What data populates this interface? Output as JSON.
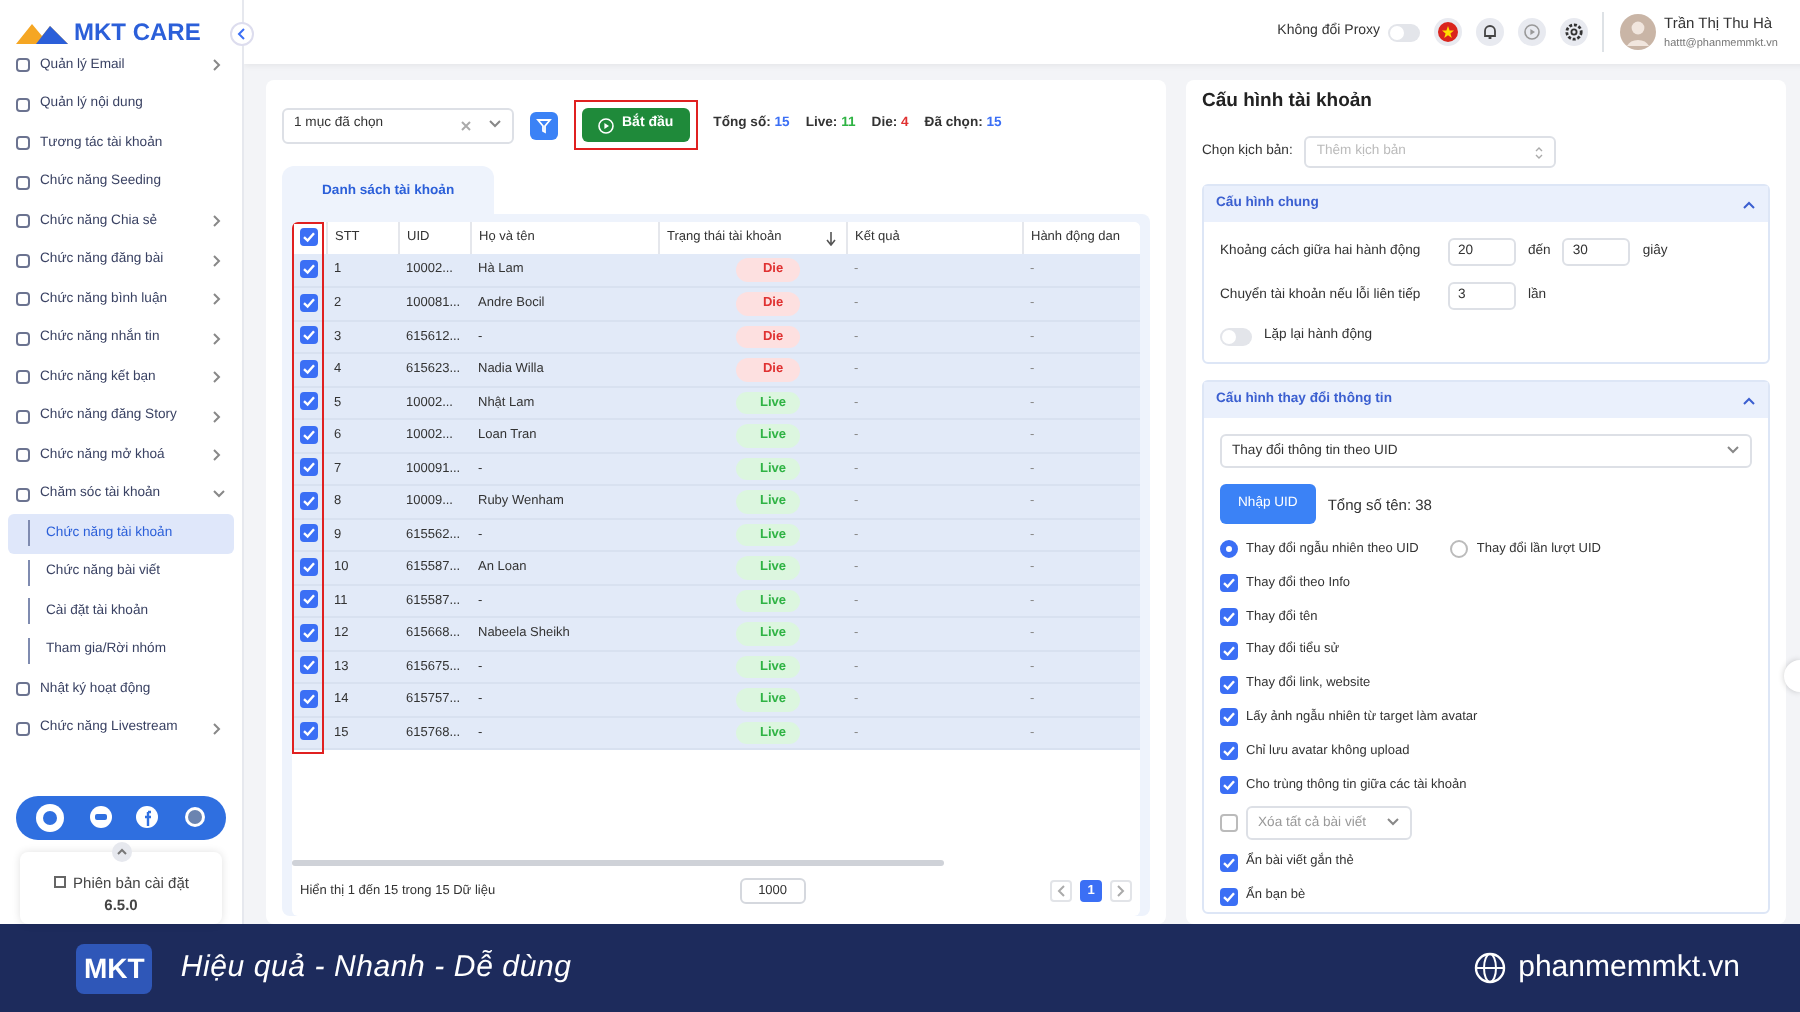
{
  "sidebar": {
    "logo": "MKT CARE",
    "items": [
      {
        "label": "Quản lý Email",
        "expanded": false
      },
      {
        "label": "Quản lý nội dung"
      },
      {
        "label": "Tương tác tài khoản"
      },
      {
        "label": "Chức năng Seeding"
      },
      {
        "label": "Chức năng Chia sẻ",
        "expanded": false
      },
      {
        "label": "Chức năng đăng bài",
        "expanded": false
      },
      {
        "label": "Chức năng bình luận",
        "expanded": false
      },
      {
        "label": "Chức năng nhắn tin",
        "expanded": false
      },
      {
        "label": "Chức năng kết bạn",
        "expanded": false
      },
      {
        "label": "Chức năng đăng Story",
        "expanded": false
      },
      {
        "label": "Chức năng mở khoá",
        "expanded": false
      },
      {
        "label": "Chăm sóc tài khoản",
        "expanded": true,
        "children": [
          {
            "label": "Chức năng tài khoản",
            "selected": true
          },
          {
            "label": "Chức năng bài viết",
            "selected": false
          },
          {
            "label": "Cài đặt tài khoản",
            "selected": false
          },
          {
            "label": "Tham gia/Rời nhóm",
            "selected": false
          }
        ]
      },
      {
        "label": "Nhật ký hoạt động"
      },
      {
        "label": "Chức năng Livestream",
        "expanded": false
      }
    ],
    "version_label": "Phiên bản cài đặt",
    "version": "6.5.0"
  },
  "top_bar": {
    "proxy_label": "Không đổi Proxy",
    "proxy_on": false,
    "user_name": "Trần Thị Thu Hà",
    "user_email": "hattt@phanmemmkt.vn"
  },
  "toolbar": {
    "select_value": "1 mục đã chọn",
    "start_button": "Bắt đầu",
    "start_highlighted": true,
    "stats": [
      {
        "label": "Tổng số:",
        "value": "15",
        "color": "#3b6ff5"
      },
      {
        "label": "Live:",
        "value": "11",
        "color": "#2fb344"
      },
      {
        "label": "Die:",
        "value": "4",
        "color": "#e03131"
      },
      {
        "label": "Đã chọn:",
        "value": "15",
        "color": "#3b6ff5"
      }
    ]
  },
  "tabs": [
    {
      "label": "Danh sách tài khoản",
      "selected": true
    }
  ],
  "table": {
    "all_checked": true,
    "checkbox_column_highlighted": true,
    "columns": [
      "STT",
      "UID",
      "Họ và tên",
      "Trạng thái tài khoản",
      "Kết quả",
      "Hành động dan"
    ],
    "rows": [
      {
        "checked": true,
        "stt": "1",
        "uid": "10002...",
        "name": "Hà Lam",
        "status": {
          "kind": "die",
          "text": "Die"
        },
        "result": "-",
        "action": "-"
      },
      {
        "checked": true,
        "stt": "2",
        "uid": "100081...",
        "name": "Andre Bocil",
        "status": {
          "kind": "die",
          "text": "Die"
        },
        "result": "-",
        "action": "-"
      },
      {
        "checked": true,
        "stt": "3",
        "uid": "615612...",
        "name": "-",
        "status": {
          "kind": "die",
          "text": "Die"
        },
        "result": "-",
        "action": "-"
      },
      {
        "checked": true,
        "stt": "4",
        "uid": "615623...",
        "name": "Nadia Willa",
        "status": {
          "kind": "die",
          "text": "Die"
        },
        "result": "-",
        "action": "-"
      },
      {
        "checked": true,
        "stt": "5",
        "uid": "10002...",
        "name": "Nhật Lam",
        "status": {
          "kind": "live",
          "text": "Live"
        },
        "result": "-",
        "action": "-"
      },
      {
        "checked": true,
        "stt": "6",
        "uid": "10002...",
        "name": "Loan Tran",
        "status": {
          "kind": "live",
          "text": "Live"
        },
        "result": "-",
        "action": "-"
      },
      {
        "checked": true,
        "stt": "7",
        "uid": "100091...",
        "name": "-",
        "status": {
          "kind": "live",
          "text": "Live"
        },
        "result": "-",
        "action": "-"
      },
      {
        "checked": true,
        "stt": "8",
        "uid": "10009...",
        "name": "Ruby Wenham",
        "status": {
          "kind": "live",
          "text": "Live"
        },
        "result": "-",
        "action": "-"
      },
      {
        "checked": true,
        "stt": "9",
        "uid": "615562...",
        "name": "-",
        "status": {
          "kind": "live",
          "text": "Live"
        },
        "result": "-",
        "action": "-"
      },
      {
        "checked": true,
        "stt": "10",
        "uid": "615587...",
        "name": "An Loan",
        "status": {
          "kind": "live",
          "text": "Live"
        },
        "result": "-",
        "action": "-"
      },
      {
        "checked": true,
        "stt": "11",
        "uid": "615587...",
        "name": "-",
        "status": {
          "kind": "live",
          "text": "Live"
        },
        "result": "-",
        "action": "-"
      },
      {
        "checked": true,
        "stt": "12",
        "uid": "615668...",
        "name": "Nabeela Sheikh",
        "status": {
          "kind": "live",
          "text": "Live"
        },
        "result": "-",
        "action": "-"
      },
      {
        "checked": true,
        "stt": "13",
        "uid": "615675...",
        "name": "-",
        "status": {
          "kind": "live",
          "text": "Live"
        },
        "result": "-",
        "action": "-"
      },
      {
        "checked": true,
        "stt": "14",
        "uid": "615757...",
        "name": "-",
        "status": {
          "kind": "live",
          "text": "Live"
        },
        "result": "-",
        "action": "-"
      },
      {
        "checked": true,
        "stt": "15",
        "uid": "615768...",
        "name": "-",
        "status": {
          "kind": "live",
          "text": "Live"
        },
        "result": "-",
        "action": "-"
      }
    ],
    "footer": "Hiển thị 1 đến 15 trong 15 Dữ liệu",
    "page_size": "1000",
    "pages": [
      {
        "label": "1",
        "selected": true
      }
    ]
  },
  "config": {
    "title": "Cấu hình tài khoản",
    "script_label": "Chọn kịch bản:",
    "script_placeholder": "Thêm kịch bản",
    "general": {
      "title": "Cấu hình chung",
      "expanded": true,
      "delay_label": "Khoảng cách giữa hai hành động",
      "delay_from": "20",
      "delay_to_label": "đến",
      "delay_to": "30",
      "delay_unit": "giây",
      "switch_label": "Chuyển tài khoản nếu lỗi liên tiếp",
      "switch_value": "3",
      "switch_unit": "lần",
      "repeat_label": "Lặp lại hành động",
      "repeat_on": false
    },
    "info": {
      "title": "Cấu hình thay đổi thông tin",
      "expanded": true,
      "mode": "Thay đổi thông tin theo UID",
      "import_button": "Nhập UID",
      "total": "Tổng số tên: 38",
      "radios": [
        {
          "label": "Thay đổi ngẫu nhiên theo UID",
          "selected": true
        },
        {
          "label": "Thay đổi lần lượt UID",
          "selected": false
        }
      ],
      "options": [
        {
          "kind": "check",
          "label": "Thay đổi theo Info",
          "checked": true
        },
        {
          "kind": "check",
          "label": "Thay đổi tên",
          "checked": true
        },
        {
          "kind": "check",
          "label": "Thay đổi tiểu sử",
          "checked": true
        },
        {
          "kind": "check",
          "label": "Thay đổi link, website",
          "checked": true
        },
        {
          "kind": "check",
          "label": "Lấy ảnh ngẫu nhiên từ target làm avatar",
          "checked": true
        },
        {
          "kind": "check",
          "label": "Chỉ lưu avatar không upload",
          "checked": true
        },
        {
          "kind": "check",
          "label": "Cho trùng thông tin giữa các tài khoản",
          "checked": true
        },
        {
          "kind": "select",
          "label": "Xóa tất cả bài viết",
          "checked": false
        },
        {
          "kind": "check",
          "label": "Ẩn bài viết gắn thẻ",
          "checked": true
        },
        {
          "kind": "check",
          "label": "Ẩn bạn bè",
          "checked": true
        }
      ]
    }
  },
  "banner": {
    "logo": "MKT",
    "slogan": "Hiệu quả - Nhanh - Dễ dùng",
    "website": "phanmemmkt.vn"
  }
}
